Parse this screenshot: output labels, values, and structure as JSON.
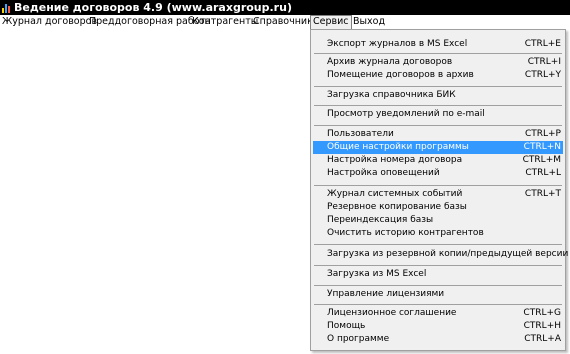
{
  "window": {
    "title": "Ведение договоров 4.9 (www.araxgroup.ru)",
    "titlebar_bg": "#000000",
    "titlebar_fg": "#ffffff",
    "icon": "bar-chart-app-icon"
  },
  "menubar": {
    "items": [
      {
        "label": "Журнал договоров"
      },
      {
        "label": "Преддоговорная работа"
      },
      {
        "label": "Контрагенты"
      },
      {
        "label": "Справочники"
      },
      {
        "label": "Сервис",
        "active": true
      },
      {
        "label": "Выход"
      }
    ]
  },
  "service_menu": {
    "highlight_color": "#3399ff",
    "items": [
      {
        "label": "Экспорт журналов в MS Excel",
        "shortcut": "CTRL+E"
      },
      {
        "label": "Архив журнала договоров",
        "shortcut": "CTRL+I"
      },
      {
        "label": "Помещение договоров в архив",
        "shortcut": "CTRL+Y"
      },
      {
        "label": "Загрузка справочника БИК",
        "shortcut": ""
      },
      {
        "label": "Просмотр уведомлений по e-mail",
        "shortcut": ""
      },
      {
        "label": "Пользователи",
        "shortcut": "CTRL+P"
      },
      {
        "label": "Общие настройки программы",
        "shortcut": "CTRL+N",
        "highlighted": true
      },
      {
        "label": "Настройка номера договора",
        "shortcut": "CTRL+M"
      },
      {
        "label": "Настройка оповещений",
        "shortcut": "CTRL+L"
      },
      {
        "label": "Журнал системных событий",
        "shortcut": "CTRL+T"
      },
      {
        "label": "Резервное копирование базы",
        "shortcut": ""
      },
      {
        "label": "Переиндексация базы",
        "shortcut": ""
      },
      {
        "label": "Очистить историю контрагентов",
        "shortcut": ""
      },
      {
        "label": "Загрузка из резервной копии/предыдущей версии",
        "shortcut": ""
      },
      {
        "label": "Загрузка из MS Excel",
        "shortcut": ""
      },
      {
        "label": "Управление лицензиями",
        "shortcut": ""
      },
      {
        "label": "Лицензионное соглашение",
        "shortcut": "CTRL+G"
      },
      {
        "label": "Помощь",
        "shortcut": "CTRL+H"
      },
      {
        "label": "О программе",
        "shortcut": "CTRL+A"
      }
    ]
  }
}
